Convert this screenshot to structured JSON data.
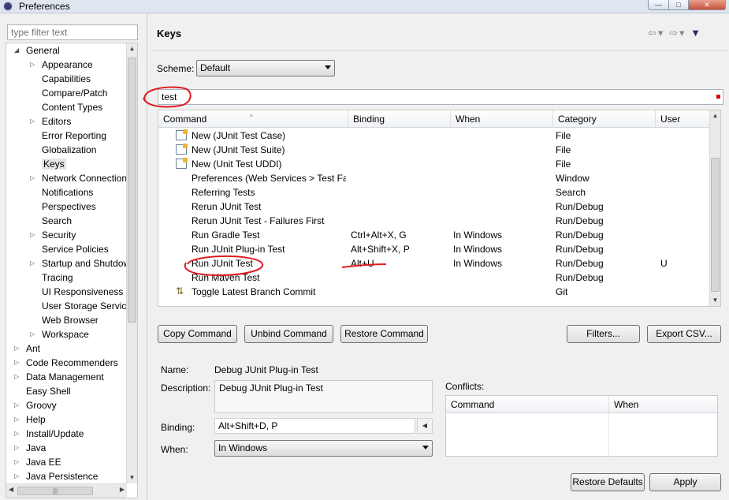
{
  "window": {
    "title": "Preferences",
    "minimize": "—",
    "maximize": "□",
    "close": "✕"
  },
  "filter": {
    "placeholder": "type filter text"
  },
  "tree": [
    {
      "label": "General",
      "level": 0,
      "arrow": "expanded"
    },
    {
      "label": "Appearance",
      "level": 1,
      "arrow": "collapsed"
    },
    {
      "label": "Capabilities",
      "level": 1,
      "arrow": ""
    },
    {
      "label": "Compare/Patch",
      "level": 1,
      "arrow": ""
    },
    {
      "label": "Content Types",
      "level": 1,
      "arrow": ""
    },
    {
      "label": "Editors",
      "level": 1,
      "arrow": "collapsed"
    },
    {
      "label": "Error Reporting",
      "level": 1,
      "arrow": ""
    },
    {
      "label": "Globalization",
      "level": 1,
      "arrow": ""
    },
    {
      "label": "Keys",
      "level": 1,
      "arrow": "",
      "selected": true
    },
    {
      "label": "Network Connection",
      "level": 1,
      "arrow": "collapsed"
    },
    {
      "label": "Notifications",
      "level": 1,
      "arrow": ""
    },
    {
      "label": "Perspectives",
      "level": 1,
      "arrow": ""
    },
    {
      "label": "Search",
      "level": 1,
      "arrow": ""
    },
    {
      "label": "Security",
      "level": 1,
      "arrow": "collapsed"
    },
    {
      "label": "Service Policies",
      "level": 1,
      "arrow": ""
    },
    {
      "label": "Startup and Shutdown",
      "level": 1,
      "arrow": "collapsed"
    },
    {
      "label": "Tracing",
      "level": 1,
      "arrow": ""
    },
    {
      "label": "UI Responsiveness Monitoring",
      "level": 1,
      "arrow": ""
    },
    {
      "label": "User Storage Service",
      "level": 1,
      "arrow": ""
    },
    {
      "label": "Web Browser",
      "level": 1,
      "arrow": ""
    },
    {
      "label": "Workspace",
      "level": 1,
      "arrow": "collapsed"
    },
    {
      "label": "Ant",
      "level": 0,
      "arrow": "collapsed"
    },
    {
      "label": "Code Recommenders",
      "level": 0,
      "arrow": "collapsed"
    },
    {
      "label": "Data Management",
      "level": 0,
      "arrow": "collapsed"
    },
    {
      "label": "Easy Shell",
      "level": 0,
      "arrow": ""
    },
    {
      "label": "Groovy",
      "level": 0,
      "arrow": "collapsed"
    },
    {
      "label": "Help",
      "level": 0,
      "arrow": "collapsed"
    },
    {
      "label": "Install/Update",
      "level": 0,
      "arrow": "collapsed"
    },
    {
      "label": "Java",
      "level": 0,
      "arrow": "collapsed"
    },
    {
      "label": "Java EE",
      "level": 0,
      "arrow": "collapsed"
    },
    {
      "label": "Java Persistence",
      "level": 0,
      "arrow": "collapsed"
    }
  ],
  "page": {
    "title": "Keys"
  },
  "scheme": {
    "label": "Scheme:",
    "value": "Default"
  },
  "search": {
    "value": "test"
  },
  "table": {
    "columns": [
      "Command",
      "Binding",
      "When",
      "Category",
      "User"
    ],
    "rows": [
      {
        "command": "New (JUnit Test Case)",
        "binding": "",
        "when": "",
        "category": "File",
        "user": "",
        "icon": "wizard"
      },
      {
        "command": "New (JUnit Test Suite)",
        "binding": "",
        "when": "",
        "category": "File",
        "user": "",
        "icon": "wizard"
      },
      {
        "command": "New (Unit Test UDDI)",
        "binding": "",
        "when": "",
        "category": "File",
        "user": "",
        "icon": "wizard"
      },
      {
        "command": "Preferences (Web Services > Test Facilities)",
        "binding": "",
        "when": "",
        "category": "Window",
        "user": "",
        "icon": ""
      },
      {
        "command": "Referring Tests",
        "binding": "",
        "when": "",
        "category": "Search",
        "user": "",
        "icon": ""
      },
      {
        "command": "Rerun JUnit Test",
        "binding": "",
        "when": "",
        "category": "Run/Debug",
        "user": "",
        "icon": ""
      },
      {
        "command": "Rerun JUnit Test - Failures First",
        "binding": "",
        "when": "",
        "category": "Run/Debug",
        "user": "",
        "icon": ""
      },
      {
        "command": "Run Gradle Test",
        "binding": "Ctrl+Alt+X, G",
        "when": "In Windows",
        "category": "Run/Debug",
        "user": "",
        "icon": ""
      },
      {
        "command": "Run JUnit Plug-in Test",
        "binding": "Alt+Shift+X, P",
        "when": "In Windows",
        "category": "Run/Debug",
        "user": "",
        "icon": ""
      },
      {
        "command": "Run JUnit Test",
        "binding": "Alt+U",
        "when": "In Windows",
        "category": "Run/Debug",
        "user": "U",
        "icon": ""
      },
      {
        "command": "Run Maven Test",
        "binding": "",
        "when": "",
        "category": "Run/Debug",
        "user": "",
        "icon": ""
      },
      {
        "command": "Toggle Latest Branch Commit",
        "binding": "",
        "when": "",
        "category": "Git",
        "user": "",
        "icon": "git"
      }
    ]
  },
  "buttons": {
    "copy": "Copy Command",
    "unbind": "Unbind Command",
    "restore": "Restore Command",
    "filters": "Filters...",
    "export": "Export CSV...",
    "restore_defaults": "Restore Defaults",
    "apply": "Apply"
  },
  "details": {
    "name_label": "Name:",
    "name_value": "Debug JUnit Plug-in Test",
    "description_label": "Description:",
    "description_value": "Debug JUnit Plug-in Test",
    "binding_label": "Binding:",
    "binding_value": "Alt+Shift+D, P",
    "when_label": "When:",
    "when_value": "In Windows"
  },
  "conflicts": {
    "label": "Conflicts:",
    "columns": [
      "Command",
      "When"
    ]
  },
  "colors": {
    "annotation": "#e0191f",
    "selection": "#e4e4e4"
  }
}
